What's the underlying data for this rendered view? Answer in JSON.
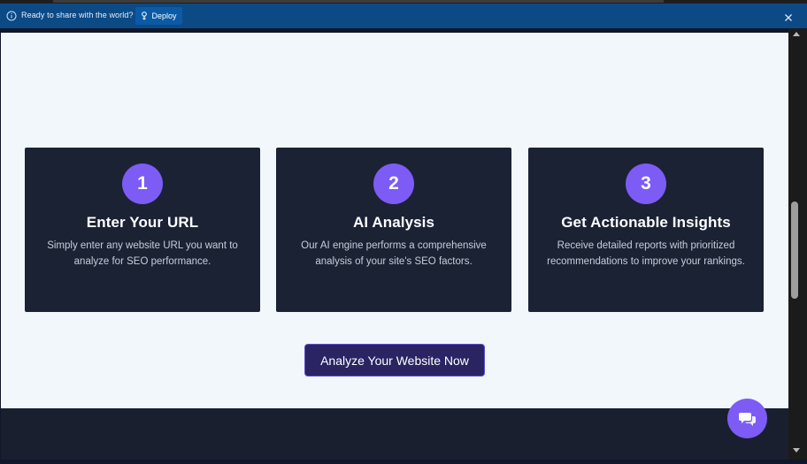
{
  "banner": {
    "message": "Ready to share with the world?",
    "deploy_label": "Deploy",
    "info_icon": "info-icon",
    "deploy_icon": "deploy-icon",
    "close_icon": "close-icon"
  },
  "steps": [
    {
      "number": "1",
      "title": "Enter Your URL",
      "description": "Simply enter any website URL you want to analyze for SEO performance."
    },
    {
      "number": "2",
      "title": "AI Analysis",
      "description": "Our AI engine performs a comprehensive analysis of your site's SEO factors."
    },
    {
      "number": "3",
      "title": "Get Actionable Insights",
      "description": "Receive detailed reports with prioritized recommendations to improve your rankings."
    }
  ],
  "cta": {
    "label": "Analyze Your Website Now"
  },
  "chat": {
    "icon": "chat-icon"
  },
  "colors": {
    "accent": "#7c5cf5",
    "card_bg": "#1b2234",
    "page_bg": "#f2f7fb",
    "banner_bg": "#0c4a86",
    "cta_bg": "#2a2462"
  }
}
